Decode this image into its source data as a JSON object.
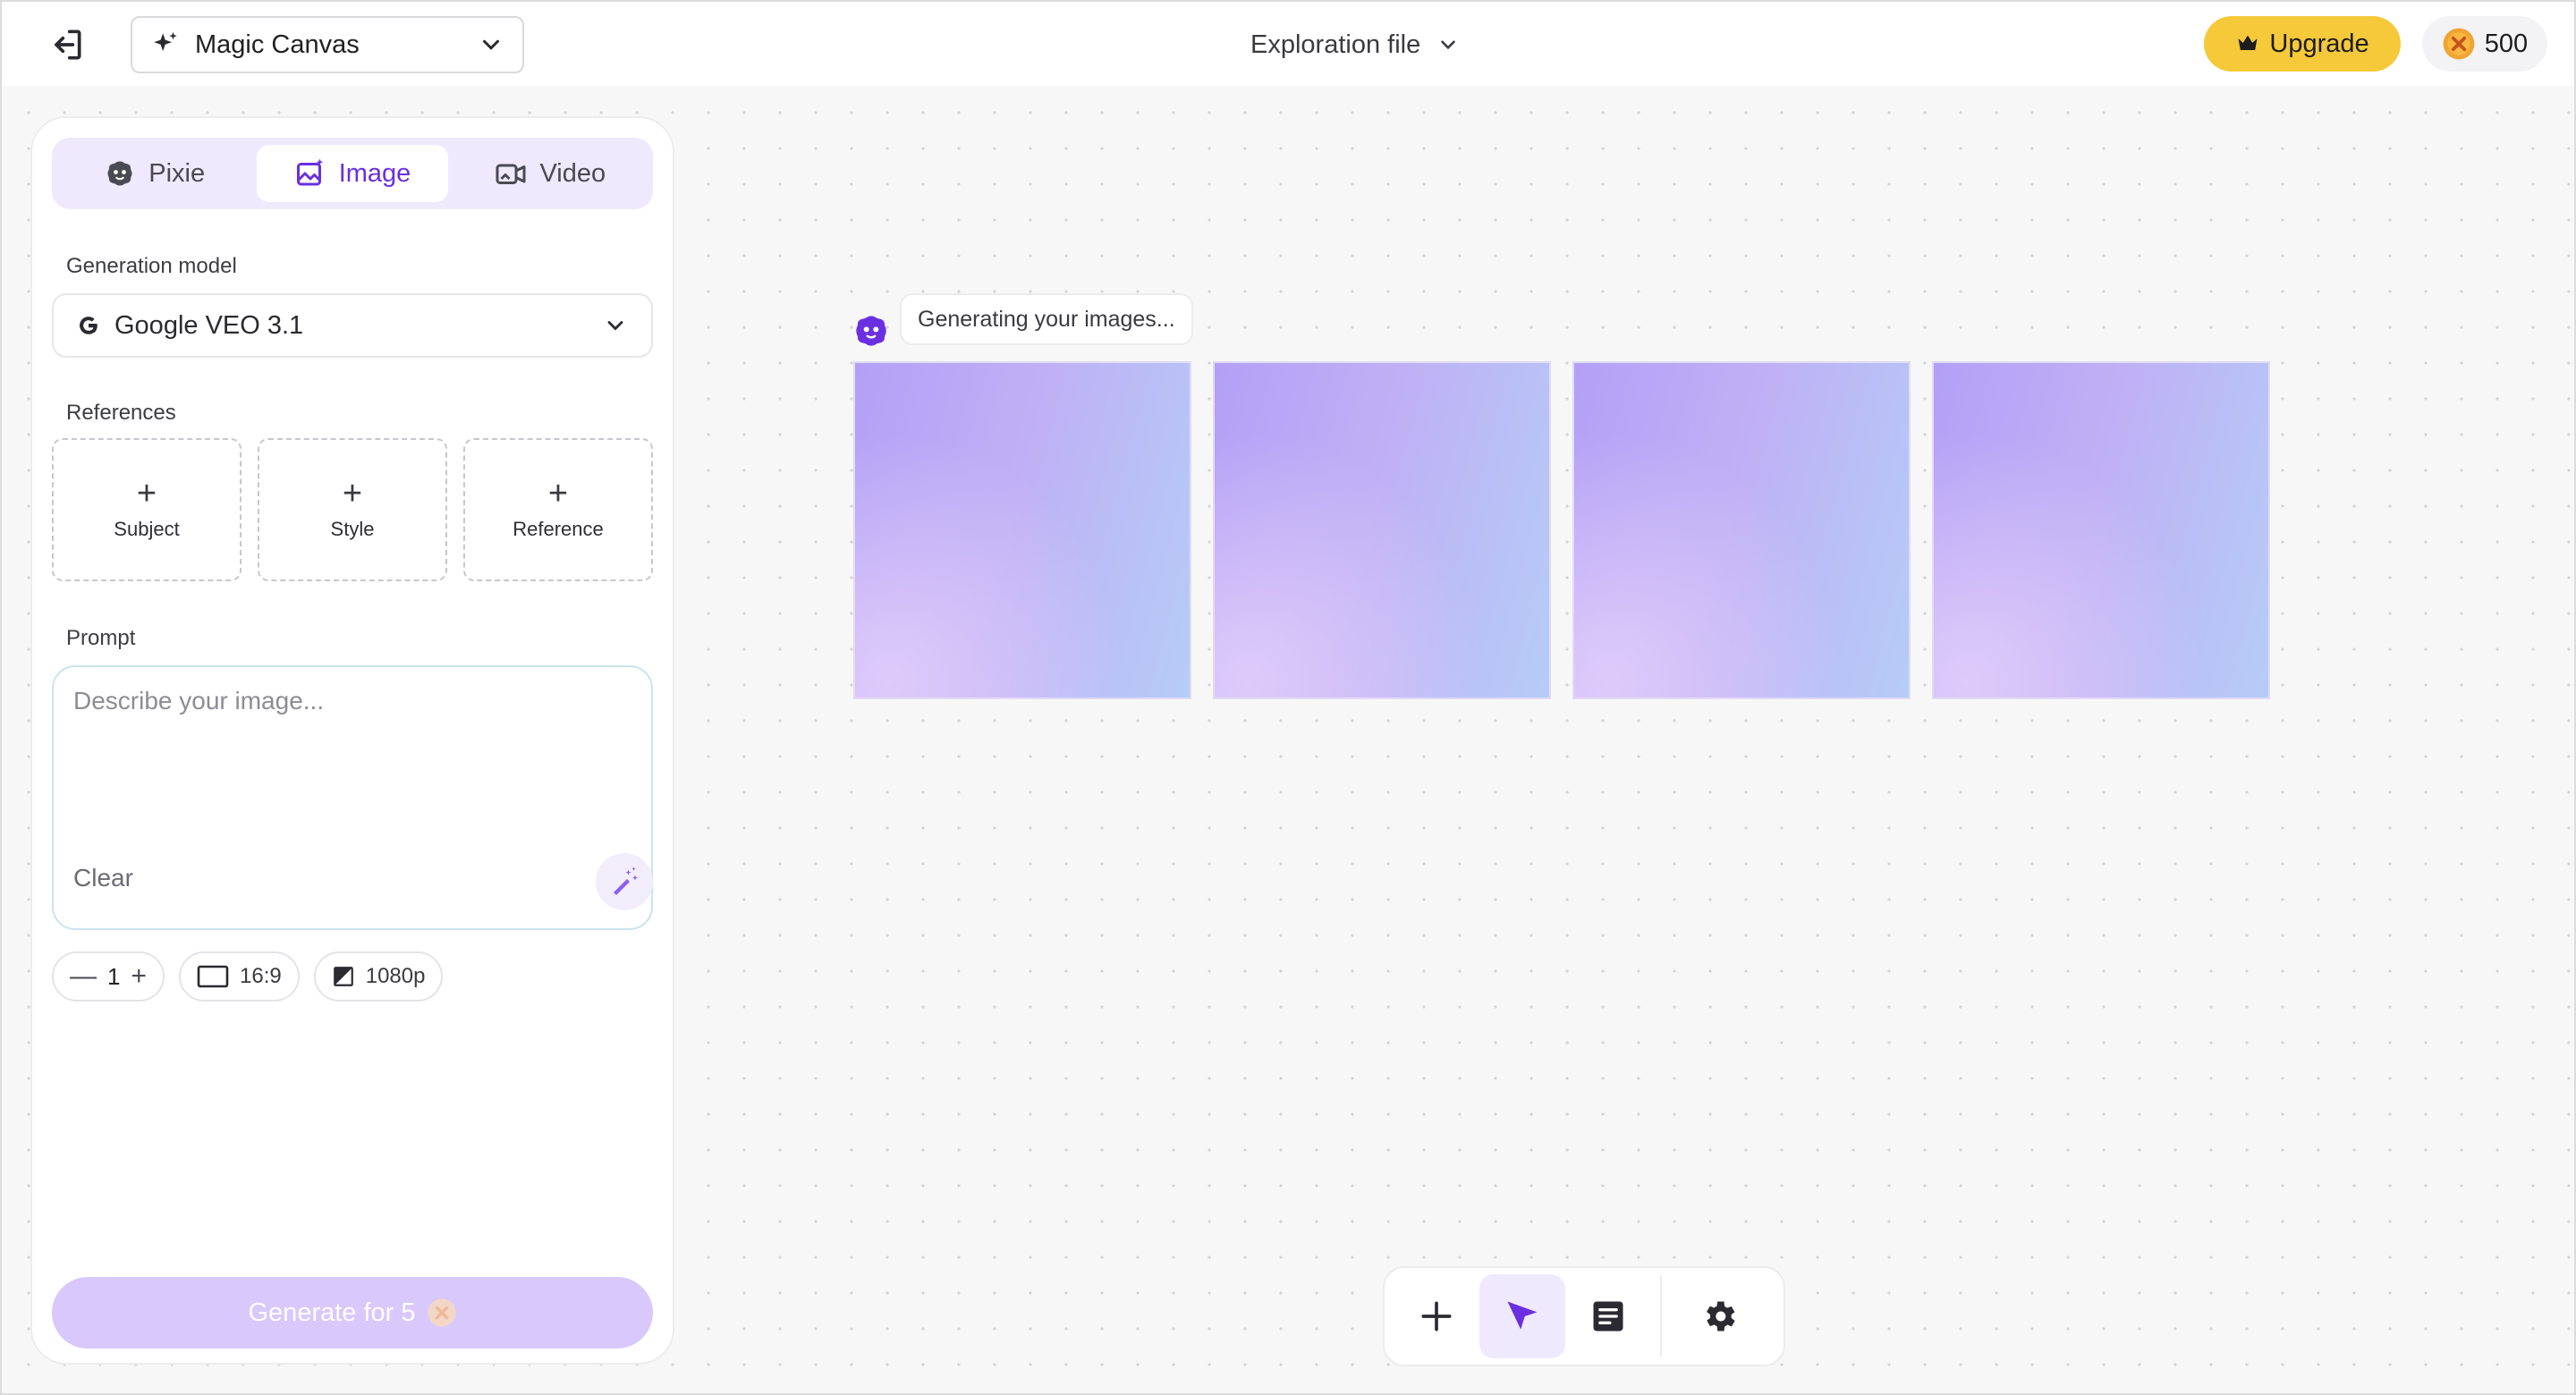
{
  "header": {
    "app_name": "Magic Canvas",
    "file_title": "Exploration file",
    "upgrade_label": "Upgrade",
    "credits": "500"
  },
  "panel": {
    "tabs": [
      {
        "label": "Pixie",
        "icon": "pixie-icon"
      },
      {
        "label": "Image",
        "icon": "image-icon",
        "active": true
      },
      {
        "label": "Video",
        "icon": "video-icon"
      }
    ],
    "model_label": "Generation model",
    "model_value": "Google VEO 3.1",
    "references_label": "References",
    "references": [
      {
        "label": "Subject"
      },
      {
        "label": "Style"
      },
      {
        "label": "Reference"
      }
    ],
    "prompt_label": "Prompt",
    "prompt_placeholder": "Describe your image...",
    "prompt_value": "",
    "clear_label": "Clear",
    "count": "1",
    "aspect_ratio": "16:9",
    "resolution": "1080p",
    "generate_label": "Generate for 5"
  },
  "canvas": {
    "status_text": "Generating your images..."
  },
  "colors": {
    "accent": "#6a2fe0",
    "upgrade": "#f5c93a",
    "generate_disabled": "#d8c8fb"
  }
}
